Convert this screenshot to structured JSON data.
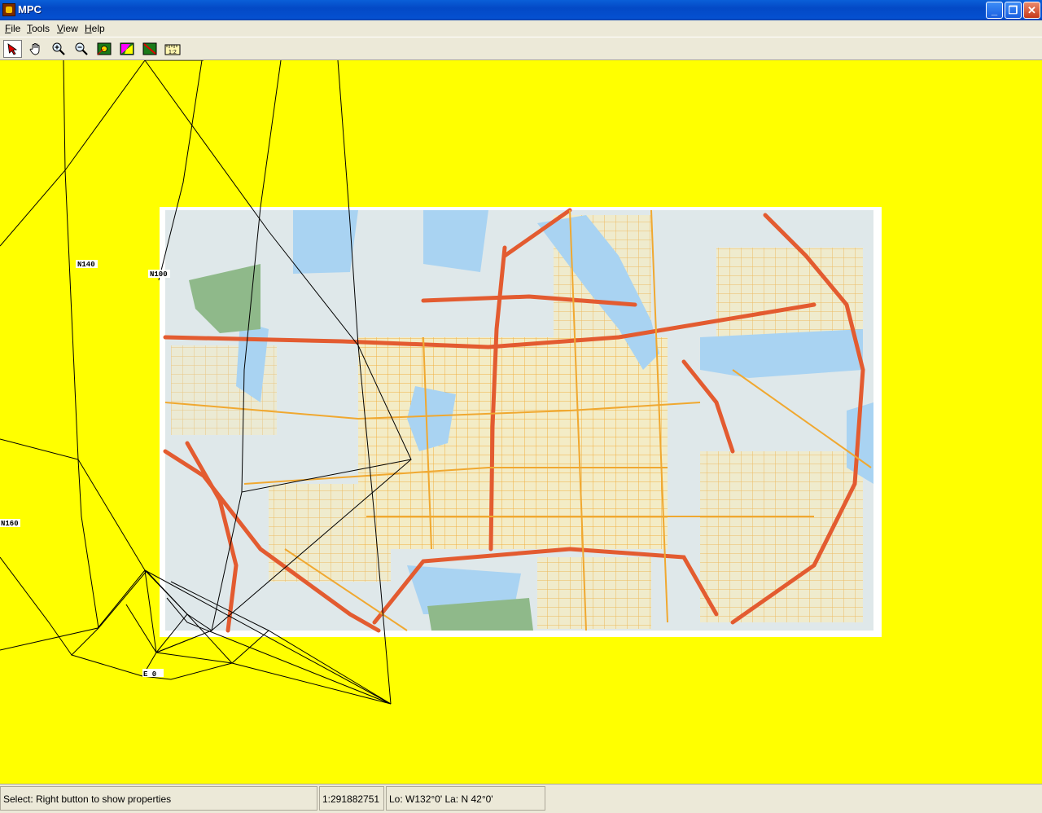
{
  "window": {
    "title": "MPC",
    "icon": "mpc-app-icon",
    "buttons": {
      "minimize": "_",
      "restore": "❐",
      "close": "✕"
    }
  },
  "menu": {
    "items": [
      {
        "label": "File",
        "accel": "F"
      },
      {
        "label": "Tools",
        "accel": "T"
      },
      {
        "label": "View",
        "accel": "V"
      },
      {
        "label": "Help",
        "accel": "H"
      }
    ]
  },
  "toolbar": {
    "tools": [
      {
        "icon": "select-arrow-icon",
        "pressed": true
      },
      {
        "icon": "pan-hand-icon",
        "pressed": false
      },
      {
        "icon": "zoom-in-icon",
        "pressed": false
      },
      {
        "icon": "zoom-out-icon",
        "pressed": false
      },
      {
        "icon": "map-layer-icon",
        "pressed": false
      },
      {
        "icon": "polygon-color-icon",
        "pressed": false
      },
      {
        "icon": "map-no-route-icon",
        "pressed": false
      },
      {
        "icon": "measure-ruler-icon",
        "pressed": false
      }
    ]
  },
  "map": {
    "background_color": "#ffff00",
    "grid_labels": [
      "N140",
      "N100",
      "N160",
      "E 0"
    ],
    "raster_image": "amsterdam-street-map"
  },
  "status": {
    "message": "Select: Right button to show properties",
    "scale": "1:291882751",
    "coords": "Lo: W132°0' La: N 42°0'"
  }
}
